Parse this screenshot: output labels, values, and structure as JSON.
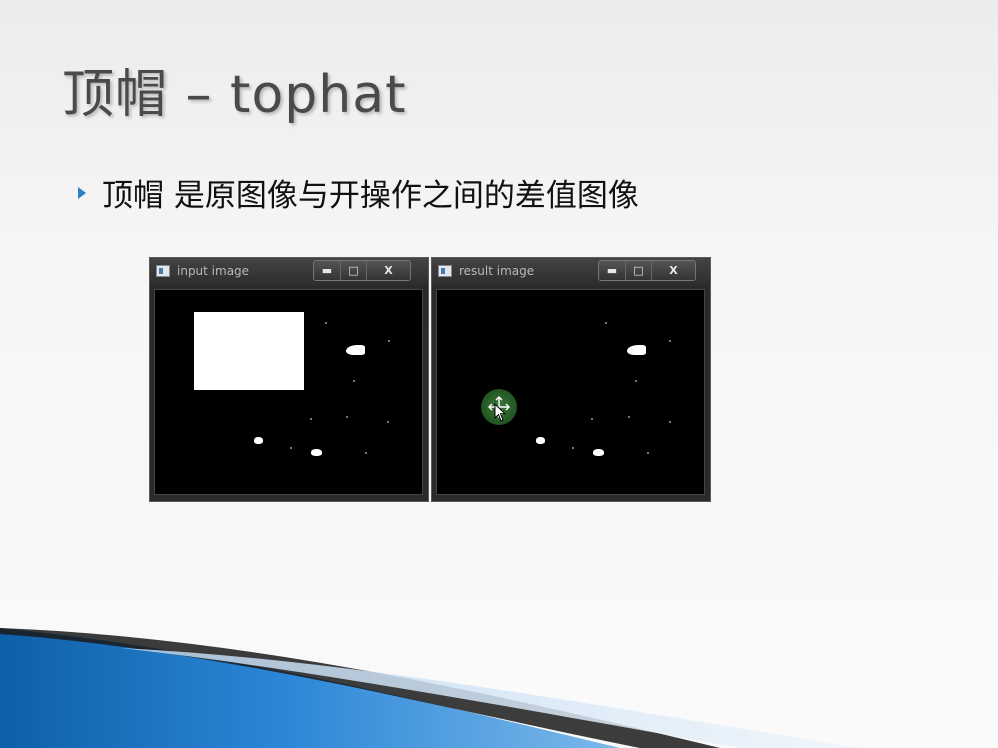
{
  "slide": {
    "title": "顶帽 – tophat",
    "bullet": "顶帽 是原图像与开操作之间的差值图像"
  },
  "windows": {
    "left": {
      "title": "input image",
      "controls": {
        "minimize": "▬",
        "maximize": "□",
        "close": "X"
      }
    },
    "right": {
      "title": "result image",
      "controls": {
        "minimize": "▬",
        "maximize": "□",
        "close": "X"
      }
    }
  },
  "colors": {
    "title_text": "#4a4a4a",
    "bullet_marker": "#2e7fc4",
    "decor_blue": "#1f6fb8",
    "cursor_highlight": "#2f6f2f"
  },
  "icons": {
    "bullet": "triangle-bullet-icon",
    "window_app": "app-window-icon",
    "cursor": "move-cursor-icon"
  }
}
